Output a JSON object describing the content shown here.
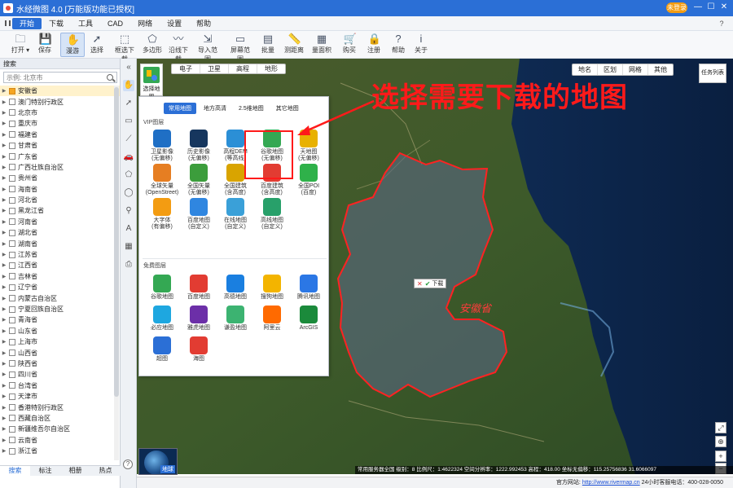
{
  "window": {
    "title": "水经微图 4.0 [万能版功能已授权]",
    "login_label": "未登录",
    "min_glyph": "—",
    "max_glyph": "☐",
    "close_glyph": "✕"
  },
  "menu": {
    "items": [
      "开始",
      "下载",
      "工具",
      "CAD",
      "网络",
      "设置",
      "帮助"
    ],
    "active_index": 0
  },
  "toolbar": {
    "buttons": [
      {
        "label": "打开 ▾",
        "icon": "folder-icon",
        "glyph": "🗀"
      },
      {
        "label": "保存",
        "icon": "save-icon",
        "glyph": "💾"
      },
      {
        "label": "漫游",
        "icon": "hand-icon",
        "glyph": "✋"
      },
      {
        "label": "选择",
        "icon": "cursor-icon",
        "glyph": "➚"
      },
      {
        "label": "框选下载",
        "icon": "box-select-icon",
        "glyph": "⬚"
      },
      {
        "label": "多边形",
        "icon": "polygon-icon",
        "glyph": "⬠"
      },
      {
        "label": "沿线下载",
        "icon": "polyline-icon",
        "glyph": "〰"
      },
      {
        "label": "导入范围",
        "icon": "import-icon",
        "glyph": "⇲"
      },
      {
        "label": "屏幕范围",
        "icon": "screen-icon",
        "glyph": "▭"
      },
      {
        "label": "批量",
        "icon": "batch-icon",
        "glyph": "▤"
      },
      {
        "label": "测距离",
        "icon": "ruler-icon",
        "glyph": "📏"
      },
      {
        "label": "量面积",
        "icon": "area-icon",
        "glyph": "▦"
      },
      {
        "label": "购买",
        "icon": "cart-icon",
        "glyph": "🛒"
      },
      {
        "label": "注册",
        "icon": "lock-icon",
        "glyph": "🔒"
      },
      {
        "label": "帮助",
        "icon": "help-icon",
        "glyph": "?"
      },
      {
        "label": "关于",
        "icon": "info-icon",
        "glyph": "i"
      }
    ],
    "active_index": 2
  },
  "left_panel": {
    "header": "搜索",
    "search_placeholder": "示例: 北京市",
    "regions": [
      "安徽省",
      "澳门特别行政区",
      "北京市",
      "重庆市",
      "福建省",
      "甘肃省",
      "广东省",
      "广西壮族自治区",
      "贵州省",
      "海南省",
      "河北省",
      "黑龙江省",
      "河南省",
      "湖北省",
      "湖南省",
      "江苏省",
      "江西省",
      "吉林省",
      "辽宁省",
      "内蒙古自治区",
      "宁夏回族自治区",
      "青海省",
      "山东省",
      "上海市",
      "山西省",
      "陕西省",
      "四川省",
      "台湾省",
      "天津市",
      "香港特别行政区",
      "西藏自治区",
      "新疆维吾尔自治区",
      "云南省",
      "浙江省"
    ],
    "selected_index": 0,
    "tabs": [
      "搜索",
      "标注",
      "相册",
      "热点"
    ],
    "active_tab": 0
  },
  "toolstrip": {
    "icons": [
      "collapse-icon",
      "hand-icon",
      "cursor-icon",
      "rect-icon",
      "polyline-icon",
      "car-icon",
      "polygon-icon",
      "circle-icon",
      "pin-icon",
      "text-icon",
      "grid-icon",
      "print-icon"
    ],
    "glyphs": [
      "«",
      "✋",
      "➚",
      "▭",
      "⟋",
      "🚗",
      "⬠",
      "◯",
      "⚲",
      "A",
      "▦",
      "⎙"
    ]
  },
  "map_type": {
    "button_label": "选择地图",
    "view_tabs": [
      "电子",
      "卫星",
      "高程",
      "地形"
    ],
    "right_buttons": [
      "地名",
      "区划",
      "网格",
      "其他"
    ],
    "task_list": "任务列表"
  },
  "popup": {
    "tabs": [
      "常用地图",
      "地方高清",
      "2.5维地图",
      "其它地图"
    ],
    "active_tab": 0,
    "vip_label": "VIP图层",
    "free_label": "免费图层",
    "vip_sources": [
      {
        "name": "卫星影像",
        "sub": "(无偏移)",
        "color": "#1f6fc5"
      },
      {
        "name": "历史影像",
        "sub": "(无偏移)",
        "color": "#16365e"
      },
      {
        "name": "高程DEM",
        "sub": "(等高线)",
        "color": "#2b8fd6"
      },
      {
        "name": "谷歌地图",
        "sub": "(无偏移)",
        "color": "#34a853"
      },
      {
        "name": "天地图",
        "sub": "(无偏移)",
        "color": "#e8b100"
      },
      {
        "name": "全球矢量",
        "sub": "(OpenStreet)",
        "color": "#e67e22"
      },
      {
        "name": "全国矢量",
        "sub": "(无偏移)",
        "color": "#3c9d3c"
      },
      {
        "name": "全国建筑",
        "sub": "(含高度)",
        "color": "#d9a400"
      },
      {
        "name": "百度建筑",
        "sub": "(含高度)",
        "color": "#e23c32"
      },
      {
        "name": "全国POI",
        "sub": "(百度)",
        "color": "#2fb14a"
      },
      {
        "name": "大字体",
        "sub": "(有偏移)",
        "color": "#f39c12"
      },
      {
        "name": "百度地图",
        "sub": "(自定义)",
        "color": "#2f86e0"
      },
      {
        "name": "在线地图",
        "sub": "(自定义)",
        "color": "#3aa0d8"
      },
      {
        "name": "高线地图",
        "sub": "(自定义)",
        "color": "#28a06a"
      }
    ],
    "free_sources": [
      {
        "name": "谷歌地图",
        "color": "#34a853"
      },
      {
        "name": "百度地图",
        "color": "#e23c32"
      },
      {
        "name": "高德地图",
        "color": "#1a7fe0"
      },
      {
        "name": "搜狗地图",
        "color": "#f3b400"
      },
      {
        "name": "腾讯地图",
        "color": "#2b77e5"
      },
      {
        "name": "必应地图",
        "color": "#1ea7e0"
      },
      {
        "name": "雅虎地图",
        "color": "#6c2fa8"
      },
      {
        "name": "谦盈地图",
        "color": "#3cb371"
      },
      {
        "name": "阿里云",
        "color": "#ff6a00"
      },
      {
        "name": "ArcGIS",
        "color": "#1b8a3b"
      },
      {
        "name": "超图",
        "color": "#2b6fd6"
      },
      {
        "name": "海图",
        "color": "#e23c32"
      }
    ],
    "selected_source": "谷歌地图"
  },
  "annotation": {
    "text": "选择需要下载的地图",
    "color": "#ff1a1a"
  },
  "map_overlay": {
    "download_label": "下载",
    "province_label": "安徽省",
    "boundary_color": "#ff2222"
  },
  "earth_button": {
    "label": "地球"
  },
  "right_controls": {
    "icons": [
      "fullscreen-icon",
      "locate-icon",
      "zoom-in-icon",
      "zoom-out-icon"
    ],
    "glyphs": [
      "⤢",
      "⊕",
      "+",
      "−"
    ]
  },
  "status_bar": {
    "text": "常用服务器全国   级别：8   比例尺：1:4622324   空间分辨率：1222.992453   高程：418.00   坐标无偏移：115.25756836  31.6066097"
  },
  "footer": {
    "prefix": "官方网站:",
    "url": "http://www.rivermap.cn",
    "hotline": "24小时客服电话：400-028-0050"
  }
}
